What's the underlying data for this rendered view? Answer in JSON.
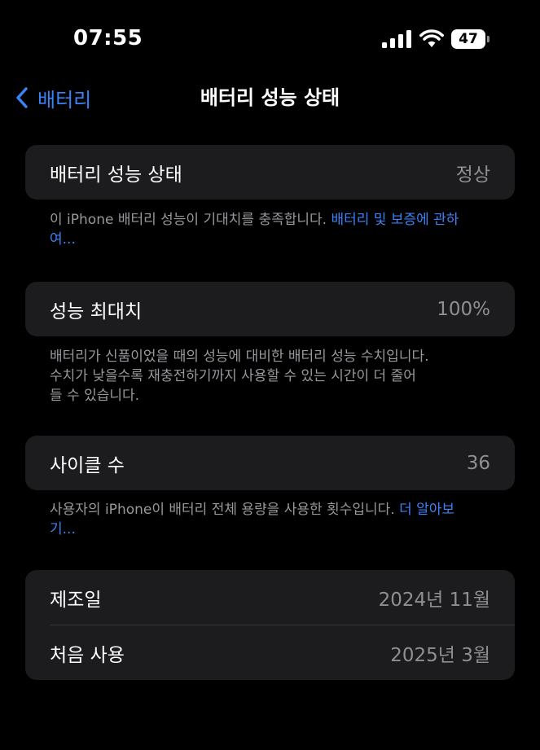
{
  "status_bar": {
    "time": "07:55",
    "battery_level": "47",
    "icons": [
      "cellular-signal-icon",
      "wifi-icon",
      "battery-icon"
    ]
  },
  "nav": {
    "back_label": "배터리",
    "title": "배터리 성능 상태"
  },
  "health": {
    "label": "배터리 성능 상태",
    "value": "정상",
    "footnote_text": "이 iPhone 배터리 성능이 기대치를 충족합니다. ",
    "footnote_link": "배터리 및 보증에 관하여..."
  },
  "max_capacity": {
    "label": "성능 최대치",
    "value": "100%",
    "footnote_line1": "배터리가 신품이었을 때의 성능에 대비한 배터리 성능 수치입니다.",
    "footnote_line2": "수치가 낮을수록 재충전하기까지 사용할 수 있는 시간이 더 줄어",
    "footnote_line3": "들 수 있습니다."
  },
  "cycle_count": {
    "label": "사이클 수",
    "value": "36",
    "footnote_text": "사용자의 iPhone이 배터리 전체 용량을 사용한 횟수입니다. ",
    "footnote_link": "더 알아보기..."
  },
  "dates": {
    "manufacture_label": "제조일",
    "manufacture_value": "2024년 11월",
    "first_use_label": "처음 사용",
    "first_use_value": "2025년 3월"
  },
  "colors": {
    "background": "#000000",
    "card": "#1c1c1e",
    "accent": "#3b82f6",
    "secondary_text": "#8e8e93"
  }
}
